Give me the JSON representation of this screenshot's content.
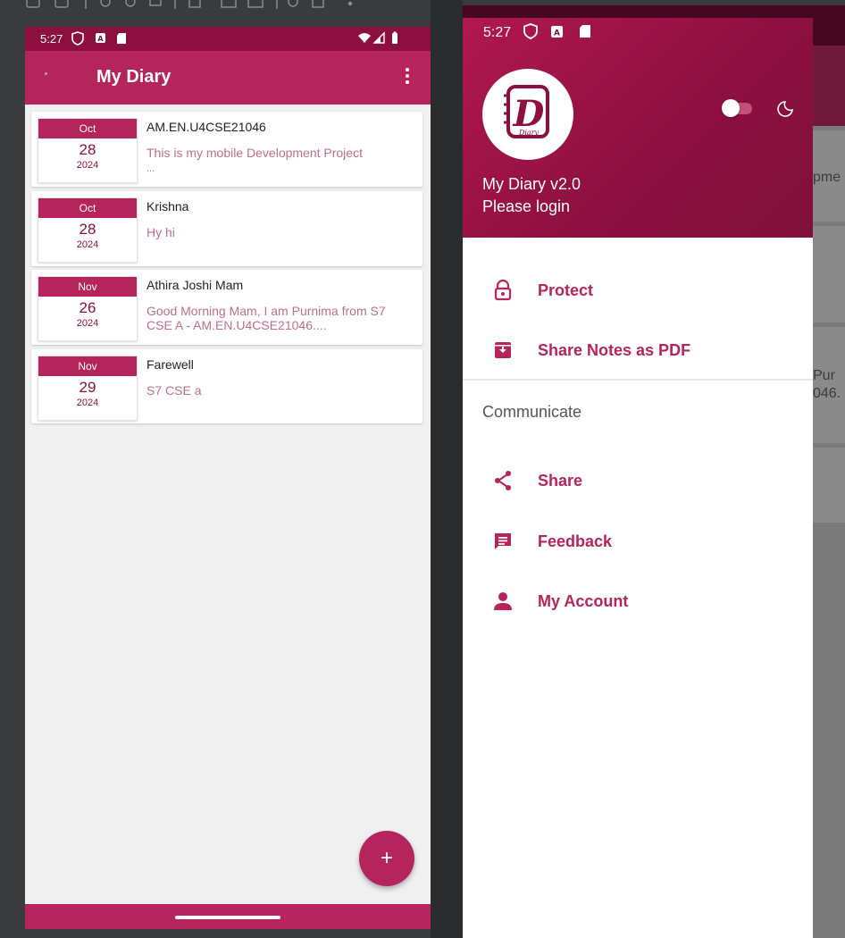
{
  "left": {
    "status_time": "5:27",
    "app_title": "My Diary",
    "notes": [
      {
        "month": "Oct",
        "day": "28",
        "year": "2024",
        "title": "AM.EN.U4CSE21046",
        "body": "This is my mobile Development Project",
        "more": "..."
      },
      {
        "month": "Oct",
        "day": "28",
        "year": "2024",
        "title": "Krishna",
        "body": "Hy hi",
        "more": ""
      },
      {
        "month": "Nov",
        "day": "26",
        "year": "2024",
        "title": "Athira Joshi Mam",
        "body": "Good Morning Mam, I am Purnima from S7 CSE A - AM.EN.U4CSE21046....",
        "more": ""
      },
      {
        "month": "Nov",
        "day": "29",
        "year": "2024",
        "title": "Farewell",
        "body": "S7 CSE a",
        "more": ""
      }
    ],
    "fab_label": "+"
  },
  "right": {
    "status_time": "5:27",
    "app_version": "My Diary v2.0",
    "login_prompt": "Please login",
    "logo_letter": "D",
    "logo_word": "Diary",
    "theme_toggle_on": false,
    "menu_main": [
      {
        "label": "Protect",
        "icon": "lock-icon"
      },
      {
        "label": "Share Notes as PDF",
        "icon": "archive-download-icon"
      }
    ],
    "section_title": "Communicate",
    "menu_communicate": [
      {
        "label": "Share",
        "icon": "share-icon"
      },
      {
        "label": "Feedback",
        "icon": "feedback-icon"
      },
      {
        "label": "My Account",
        "icon": "account-icon"
      }
    ],
    "bg_snippets": [
      "pme",
      "Pur",
      "046."
    ]
  },
  "colors": {
    "primary": "#b5245b",
    "primary_dark": "#8c0f3f",
    "note_body": "#bd6e8a"
  }
}
